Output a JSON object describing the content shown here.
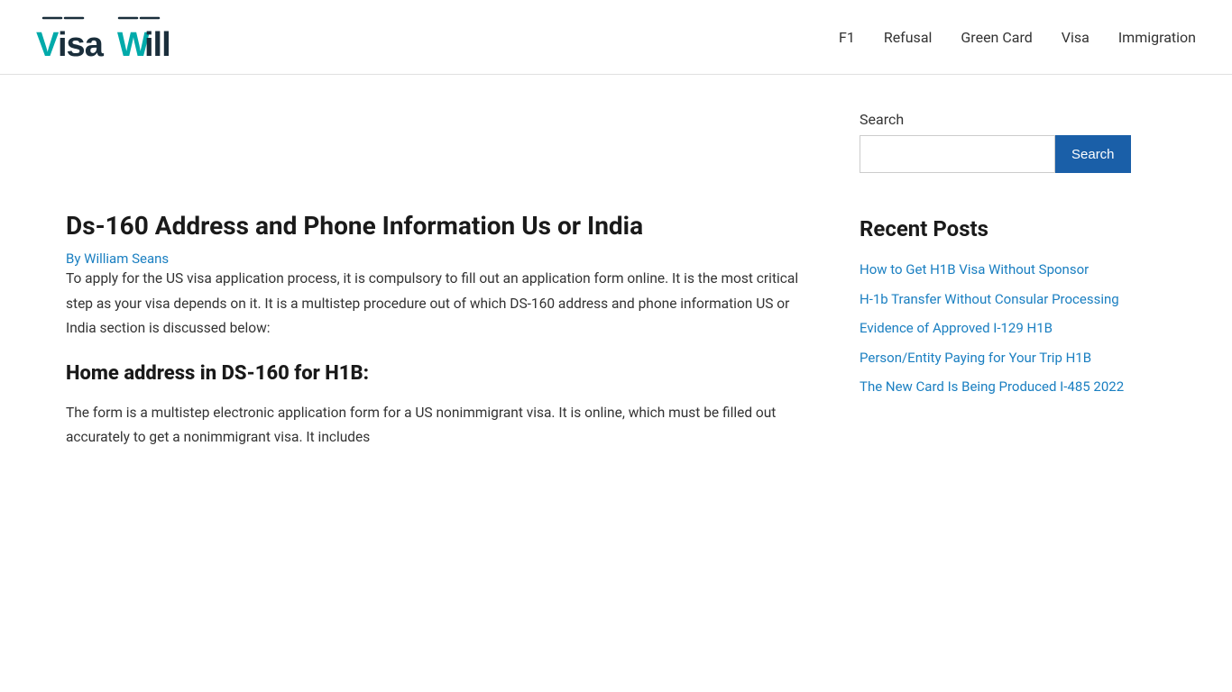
{
  "header": {
    "logo_text_visa": "Visa",
    "logo_text_will": "Will",
    "nav": {
      "items": [
        {
          "label": "F1",
          "href": "#"
        },
        {
          "label": "Refusal",
          "href": "#"
        },
        {
          "label": "Green Card",
          "href": "#"
        },
        {
          "label": "Visa",
          "href": "#"
        },
        {
          "label": "Immigration",
          "href": "#"
        }
      ]
    }
  },
  "sidebar": {
    "search_label": "Search",
    "search_button_label": "Search",
    "search_placeholder": "",
    "recent_posts_title": "Recent Posts",
    "recent_posts": [
      {
        "label": "How to Get H1B Visa Without Sponsor",
        "href": "#"
      },
      {
        "label": "H-1b Transfer Without Consular Processing",
        "href": "#"
      },
      {
        "label": "Evidence of Approved I-129 H1B",
        "href": "#"
      },
      {
        "label": "Person/Entity Paying for Your Trip H1B",
        "href": "#"
      },
      {
        "label": "The New Card Is Being Produced I-485 2022",
        "href": "#"
      }
    ]
  },
  "article": {
    "title": "Ds-160 Address and Phone Information Us or India",
    "author": "By William Seans",
    "intro": "To apply for the US visa application process, it is compulsory to fill out an application form online. It is the most critical step as your visa depends on it. It is a multistep procedure out of which DS-160 address and phone information US or India section is discussed below:",
    "section_heading": "Home address in DS-160 for H1B:",
    "section_body": "The form is a multistep electronic application form for a US nonimmigrant visa. It is online, which must be filled out accurately to get a nonimmigrant visa. It includes"
  }
}
